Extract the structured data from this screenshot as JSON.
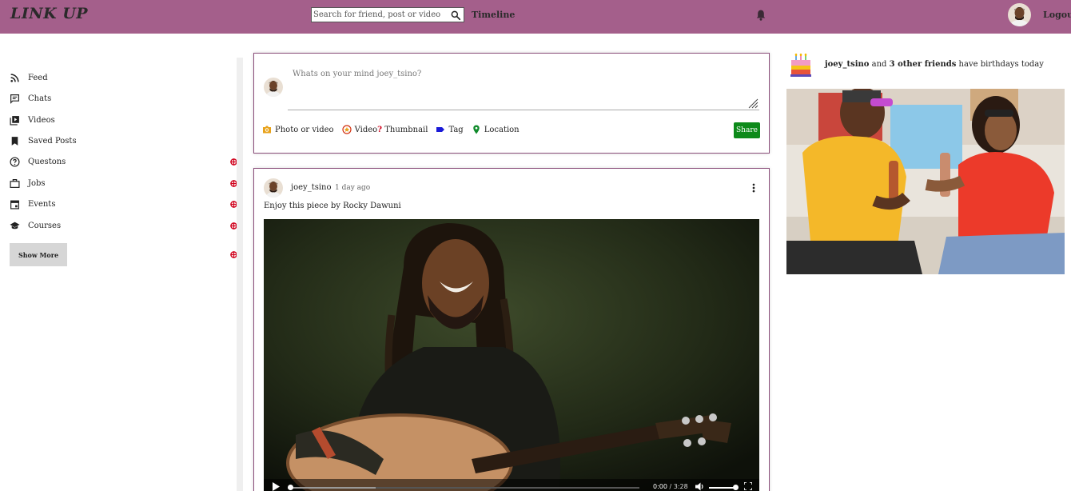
{
  "header": {
    "logo": "LINK UP",
    "search_placeholder": "Search for friend, post or video",
    "search_icon": "search-icon",
    "nav_timeline": "Timeline",
    "bell_icon": "bell-icon",
    "logout": "Logout"
  },
  "sidebar": {
    "items": [
      {
        "label": "Feed",
        "icon": "rss-icon",
        "badge": false
      },
      {
        "label": "Chats",
        "icon": "chat-icon",
        "badge": false
      },
      {
        "label": "Videos",
        "icon": "video-library-icon",
        "badge": false
      },
      {
        "label": "Saved Posts",
        "icon": "bookmark-icon",
        "badge": false
      },
      {
        "label": "Questons",
        "icon": "help-circle-icon",
        "badge": true
      },
      {
        "label": "Jobs",
        "icon": "briefcase-icon",
        "badge": true
      },
      {
        "label": "Events",
        "icon": "calendar-icon",
        "badge": true
      },
      {
        "label": "Courses",
        "icon": "school-icon",
        "badge": true
      }
    ],
    "show_more": "Show More"
  },
  "composer": {
    "placeholder": "Whats on your mind joey_tsino?",
    "options": [
      {
        "label": "Photo or video",
        "icon": "photo-icon"
      },
      {
        "label": "Video",
        "suffix": "?",
        "label2": " Thumbnail",
        "icon": "star-badge-icon"
      },
      {
        "label": "Tag",
        "icon": "tag-icon"
      },
      {
        "label": "Location",
        "icon": "location-pin-icon"
      }
    ],
    "share": "Share"
  },
  "post": {
    "username": "joey_tsino",
    "time": "1 day ago",
    "caption": "Enjoy this piece by Rocky Dawuni",
    "video": {
      "current_time": "0:00",
      "separator": " / ",
      "duration": "3:28",
      "progress": 0.0,
      "volume": 1.0
    }
  },
  "right": {
    "birthday": {
      "user": "joey_tsino",
      "middle": " and ",
      "friends": "3 other friends",
      "suffix": " have birthdays today"
    }
  },
  "colors": {
    "header_bg": "#a45f8b",
    "card_border": "#8a4d7a",
    "share_green": "#0d8a1a",
    "badge_red": "#d0001b"
  }
}
